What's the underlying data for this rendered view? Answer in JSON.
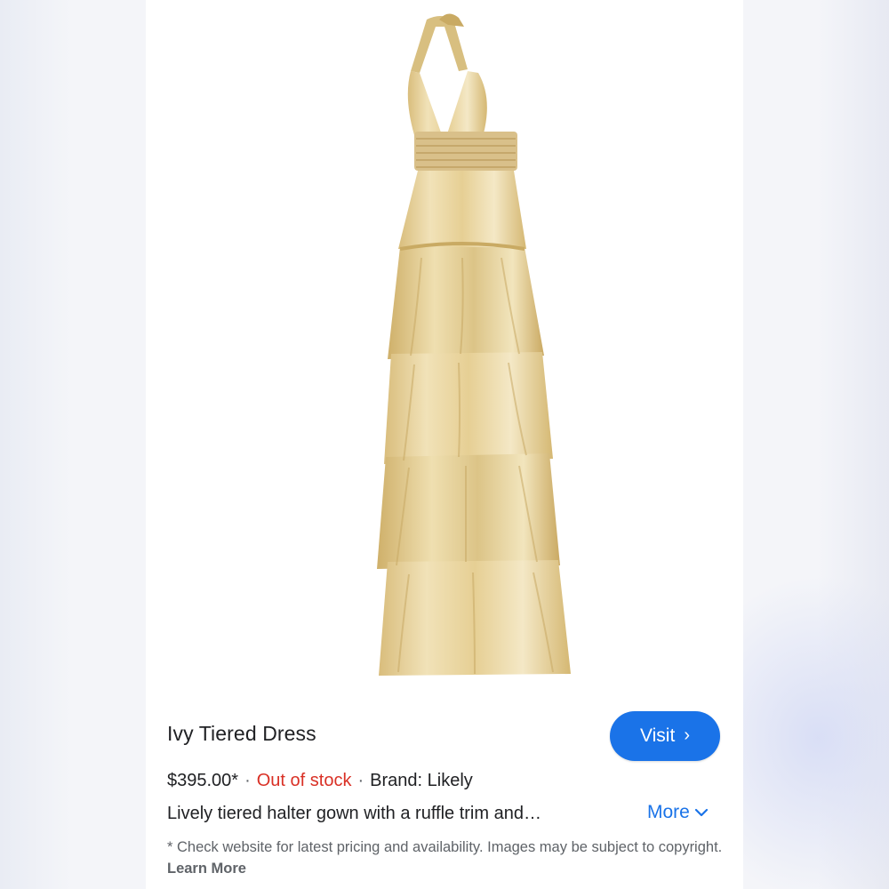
{
  "product": {
    "title": "Ivy Tiered Dress",
    "price": "$395.00*",
    "separator": "·",
    "stock_status": "Out of stock",
    "brand": "Brand: Likely",
    "description": "Lively tiered halter gown with a ruffle trim and…",
    "image_icon": "dress-product-photo"
  },
  "actions": {
    "visit_label": "Visit",
    "visit_chevron": "›",
    "more_label": "More",
    "more_chevron": "⌄"
  },
  "disclaimer": {
    "text": "* Check website for latest pricing and availability. Images may be subject to copyright.",
    "learn_more": "Learn More"
  },
  "colors": {
    "accent": "#1a73e8",
    "out_of_stock": "#d93025",
    "title_text": "#202124",
    "secondary_text": "#5f6368",
    "dress_gold": "#e8cf8f",
    "dress_light": "#f3e6c0"
  }
}
